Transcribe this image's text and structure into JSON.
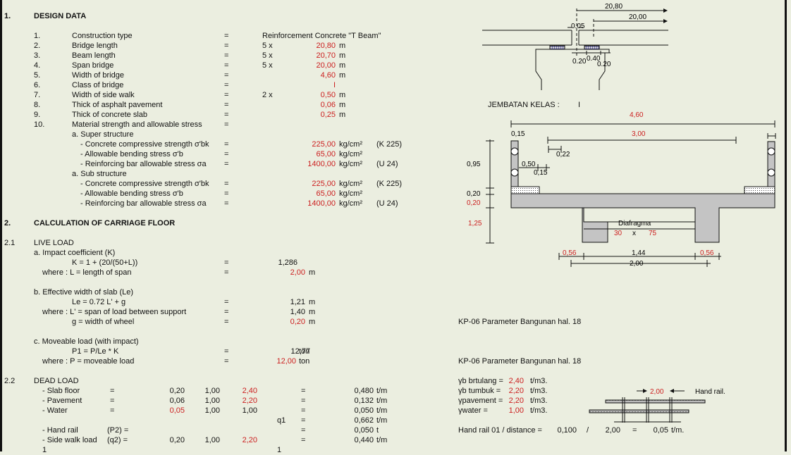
{
  "section1": {
    "num": "1.",
    "title": "DESIGN DATA",
    "items": [
      {
        "num": "1.",
        "label": "Construction type",
        "eq": "=",
        "mult": "",
        "value": "Reinforcement Concrete \"T Beam\"",
        "unit": ""
      },
      {
        "num": "2.",
        "label": "Bridge length",
        "eq": "=",
        "mult": "5 x",
        "value": "20,80",
        "unit": "m"
      },
      {
        "num": "3.",
        "label": "Beam length",
        "eq": "=",
        "mult": "5 x",
        "value": "20,70",
        "unit": "m"
      },
      {
        "num": "4.",
        "label": "Span bridge",
        "eq": "=",
        "mult": "5 x",
        "value": "20,00",
        "unit": "m"
      },
      {
        "num": "5.",
        "label": "Width of bridge",
        "eq": "=",
        "mult": "",
        "value": "4,60",
        "unit": "m"
      },
      {
        "num": "6.",
        "label": "Class of bridge",
        "eq": "=",
        "mult": "",
        "value": "I",
        "unit": ""
      },
      {
        "num": "7.",
        "label": "Width of side walk",
        "eq": "=",
        "mult": "2 x",
        "value": "0,50",
        "unit": "m"
      },
      {
        "num": "8.",
        "label": "Thick of asphalt pavement",
        "eq": "=",
        "mult": "",
        "value": "0,06",
        "unit": "m"
      },
      {
        "num": "9.",
        "label": "Thick of concrete slab",
        "eq": "=",
        "mult": "",
        "value": "0,25",
        "unit": "m"
      },
      {
        "num": "10.",
        "label": "Material strength and allowable stress",
        "eq": "=",
        "mult": "",
        "value": "",
        "unit": ""
      }
    ],
    "super_title": "a. Super structure",
    "super": [
      {
        "label": "- Concrete compressive strength σ'bk",
        "eq": "=",
        "value": "225,00",
        "unit": "kg/cm²",
        "note": "(K 225)"
      },
      {
        "label": "- Allowable bending stress σ'b",
        "eq": "=",
        "value": "65,00",
        "unit": "kg/cm²",
        "note": ""
      },
      {
        "label": "- Reinforcing bar allowable stress σa",
        "eq": "=",
        "value": "1400,00",
        "unit": "kg/cm²",
        "note": "(U 24)"
      }
    ],
    "sub_title": "a. Sub structure",
    "sub": [
      {
        "label": "- Concrete compressive strength σ'bk",
        "eq": "=",
        "value": "225,00",
        "unit": "kg/cm²",
        "note": "(K 225)"
      },
      {
        "label": "- Allowable bending stress σ'b",
        "eq": "=",
        "value": "65,00",
        "unit": "kg/cm²",
        "note": ""
      },
      {
        "label": "- Reinforcing bar allowable stress σa",
        "eq": "=",
        "value": "1400,00",
        "unit": "kg/cm²",
        "note": "(U 24)"
      }
    ]
  },
  "section2": {
    "num": "2.",
    "title": "CALCULATION OF CARRIAGE FLOOR",
    "live": {
      "num": "2.1",
      "title": "LIVE LOAD",
      "a_title": "a. Impact coefficient (K)",
      "a_formula": "K = 1 + (20/(50+L))",
      "a_value": "1,286",
      "a_where": "where : L = length of span",
      "a_where_value": "2,00",
      "a_where_unit": "m",
      "b_title": "b. Effective width of slab (Le)",
      "b_formula": "Le = 0.72 L' + g",
      "b_value": "1,21",
      "b_unit": "m",
      "b_where": "where : L' = span of load between support",
      "b_where_value": "1,40",
      "b_where_unit": "m",
      "b_g": "g  = width of wheel",
      "b_g_value": "0,20",
      "b_g_unit": "m",
      "c_title": "c. Moveable load (with impact)",
      "c_formula": "P1 = P/Le * K",
      "c_value": "12,77",
      "c_unit": "ton",
      "c_where": "where : P  = moveable load",
      "c_where_value": "12,00",
      "c_where_unit": "ton",
      "eq": "="
    },
    "dead": {
      "num": "2.2",
      "title": "DEAD LOAD",
      "eq": "=",
      "rows": [
        {
          "label": "- Slab floor",
          "pre": "=",
          "v1": "0,20",
          "v1red": false,
          "v2": "1,00",
          "v3": "2,40",
          "v3red": true,
          "q": "",
          "result": "0,480",
          "unit": "t/m"
        },
        {
          "label": "- Pavement",
          "pre": "=",
          "v1": "0,06",
          "v1red": false,
          "v2": "1,00",
          "v3": "2,20",
          "v3red": true,
          "q": "",
          "result": "0,132",
          "unit": "t/m"
        },
        {
          "label": "- Water",
          "pre": "=",
          "v1": "0,05",
          "v1red": true,
          "v2": "1,00",
          "v3": "1,00",
          "v3red": false,
          "q": "",
          "result": "0,050",
          "unit": "t/m"
        },
        {
          "label": "",
          "pre": "",
          "v1": "",
          "v1red": false,
          "v2": "",
          "v3": "",
          "v3red": false,
          "q": "q1",
          "result": "0,662",
          "unit": "t/m"
        },
        {
          "label": "- Hand rail",
          "pre": "(P2) =",
          "v1": "",
          "v1red": false,
          "v2": "",
          "v3": "",
          "v3red": false,
          "q": "",
          "result": "0,050",
          "unit": "t"
        },
        {
          "label": "- Side walk load",
          "pre": "(q2)  =",
          "v1": "0,20",
          "v1red": false,
          "v2": "1,00",
          "v3": "2,20",
          "v3red": true,
          "q": "",
          "result": "0,440",
          "unit": "t/m"
        }
      ]
    }
  },
  "right": {
    "top_diagram": {
      "dim_bridge": "20,80",
      "dim_span": "20,00",
      "gap": "0.05",
      "d1": "0.20",
      "d2": "0.40",
      "d3": "0.20"
    },
    "cross_section": {
      "title": "JEMBATAN  KELAS  :",
      "class": "I",
      "width_total": "4,60",
      "width_road": "3,00",
      "rail_w": "0,15",
      "d022": "0,22",
      "d050": "0,50",
      "d015": "0,15",
      "h095": "0,95",
      "h020a": "0,20",
      "h020b": "0,20",
      "h125": "1,25",
      "diafragma": "Diafragma",
      "diaf_w": "30",
      "diaf_x": "x",
      "diaf_h": "75",
      "b056a": "0,56",
      "b144": "1,44",
      "b056b": "0,56",
      "b200": "2,00"
    },
    "ref1": "KP-06 Parameter Bangunan hal. 18",
    "ref2": "KP-06 Parameter Bangunan hal. 18",
    "gammas": [
      {
        "label": "γb brtulang =",
        "value": "2,40",
        "unit": "t/m3."
      },
      {
        "label": "γb tumbuk =",
        "value": "2,20",
        "unit": "t/m3."
      },
      {
        "label": "γpavement =",
        "value": "2,20",
        "unit": "t/m3."
      },
      {
        "label": "γwater     =",
        "value": "1,00",
        "unit": "t/m3."
      }
    ],
    "handrail_spacing": "2,00",
    "handrail_label": "Hand rail.",
    "handrail_calc": {
      "label": "Hand rail 01 / distance =",
      "a": "0,100",
      "op": "/",
      "b": "2,00",
      "eq": "=",
      "result": "0,05",
      "unit": "t/m."
    }
  },
  "bottom_cut": {
    "a": "1",
    "b": "1"
  }
}
